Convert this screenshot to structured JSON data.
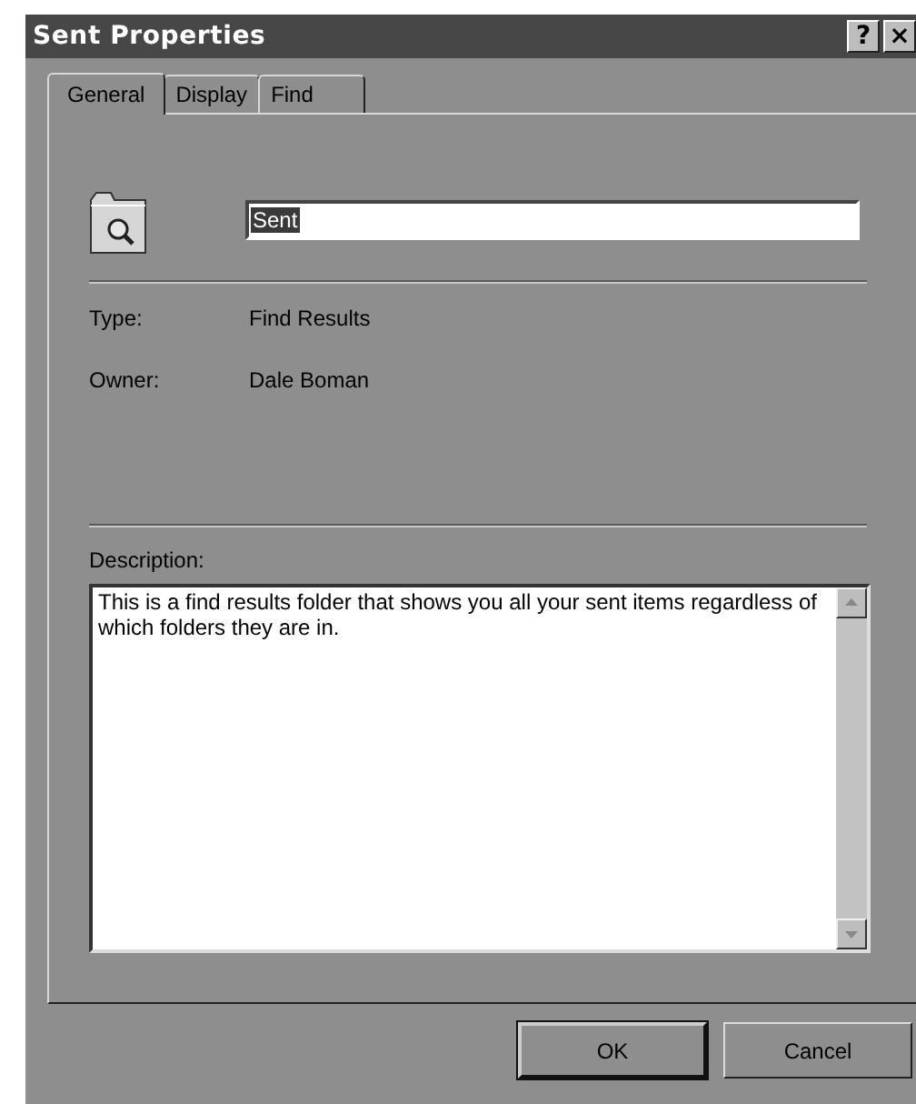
{
  "window": {
    "title": "Sent Properties",
    "title_buttons": [
      "?",
      "×"
    ]
  },
  "tabs": [
    {
      "label": "General",
      "selected": true
    },
    {
      "label": "Display",
      "selected": false
    },
    {
      "label": "Find",
      "selected": false
    }
  ],
  "name_field": {
    "value": "Sent",
    "text_selected": true
  },
  "properties": [
    {
      "label": "Type:",
      "value": "Find Results"
    },
    {
      "label": "Owner:",
      "value": "Dale Boman"
    }
  ],
  "description": {
    "label": "Description:",
    "text": "This is a find results folder that shows you all your sent items regardless of which folders they are in."
  },
  "buttons": [
    {
      "label": "OK",
      "default": true
    },
    {
      "label": "Cancel",
      "default": false
    }
  ]
}
